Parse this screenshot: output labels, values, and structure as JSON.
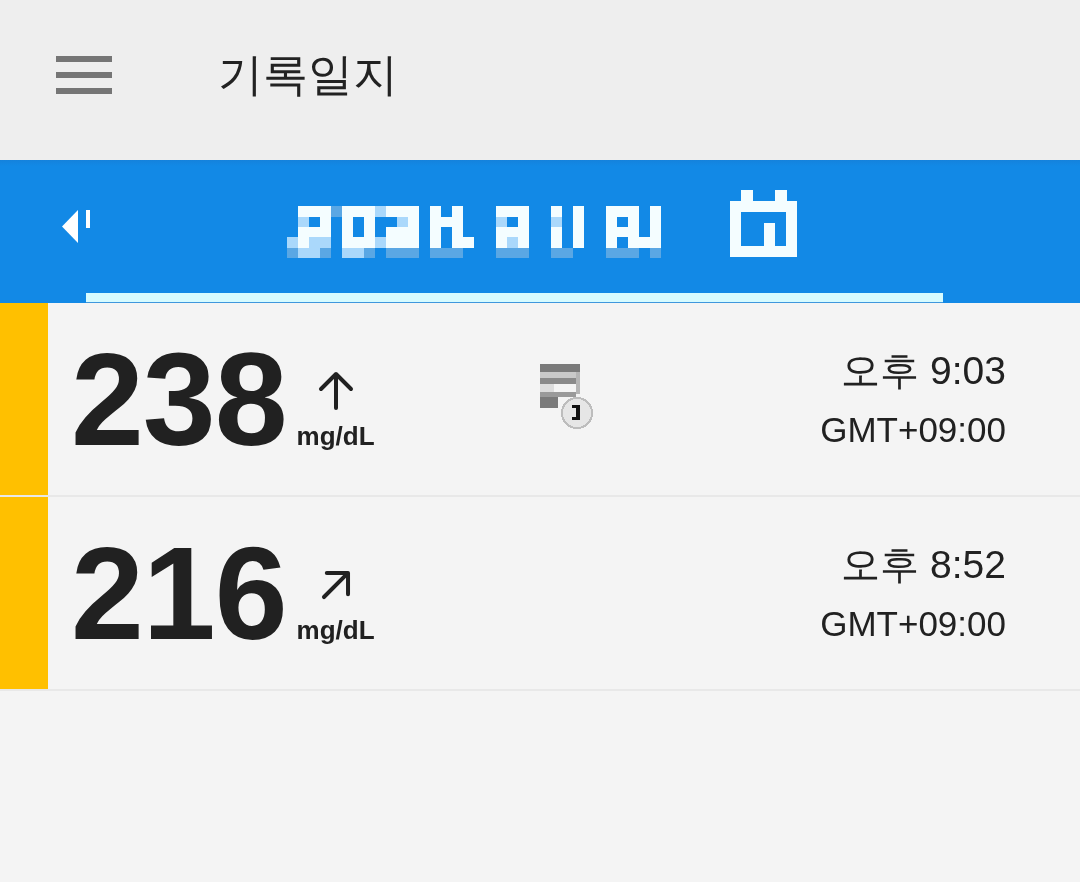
{
  "header": {
    "title": "기록일지"
  },
  "readings": [
    {
      "value": "238",
      "unit": "mg/dL",
      "trend": {
        "kind": "up"
      },
      "note": true,
      "time": "오후 9:03",
      "timezone": "GMT+09:00",
      "color": "#ffc000"
    },
    {
      "value": "216",
      "unit": "mg/dL",
      "trend": {
        "kind": "upright"
      },
      "note": false,
      "time": "오후 8:52",
      "timezone": "GMT+09:00",
      "color": "#ffc000"
    }
  ]
}
